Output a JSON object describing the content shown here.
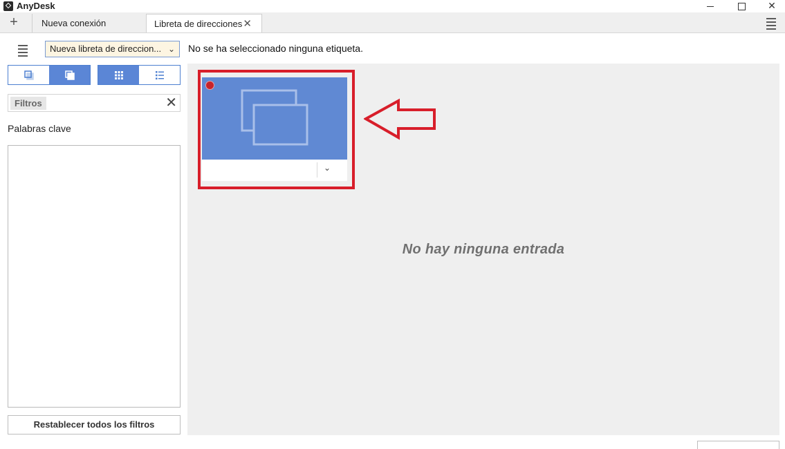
{
  "window": {
    "app_title": "AnyDesk",
    "close_glyph": "✕"
  },
  "tabs": {
    "add_glyph": "+",
    "items": [
      {
        "label": "Nueva conexión"
      },
      {
        "label": "Libreta de direcciones",
        "close_glyph": "✕"
      }
    ]
  },
  "toolbar": {
    "address_book": "Nueva libreta de direccion...",
    "chevron_glyph": "⌄",
    "tag_status": "No se ha seleccionado ninguna etiqueta."
  },
  "sidebar": {
    "filter_chip": "Filtros",
    "clear_glyph": "✕",
    "keywords_label": "Palabras clave",
    "reset_button": "Restablecer todos los filtros"
  },
  "main": {
    "empty_message": "No hay ninguna entrada",
    "entry_chevron": "⌄"
  },
  "icons": {
    "logo": "anydesk-logo-icon",
    "menu": "hamburger-menu-icon",
    "single_window": "single-window-icon",
    "multi_window": "multi-window-icon",
    "grid_view": "grid-view-icon",
    "list_view": "list-view-icon",
    "status": "offline-status-dot-icon",
    "annotation": "outline-arrow-left-icon"
  },
  "colors": {
    "accent": "#5b86d6",
    "thumbnail": "#6089d3",
    "annotation_red": "#d81e2a",
    "status_red": "#c7232b",
    "main_bg": "#efefef"
  }
}
